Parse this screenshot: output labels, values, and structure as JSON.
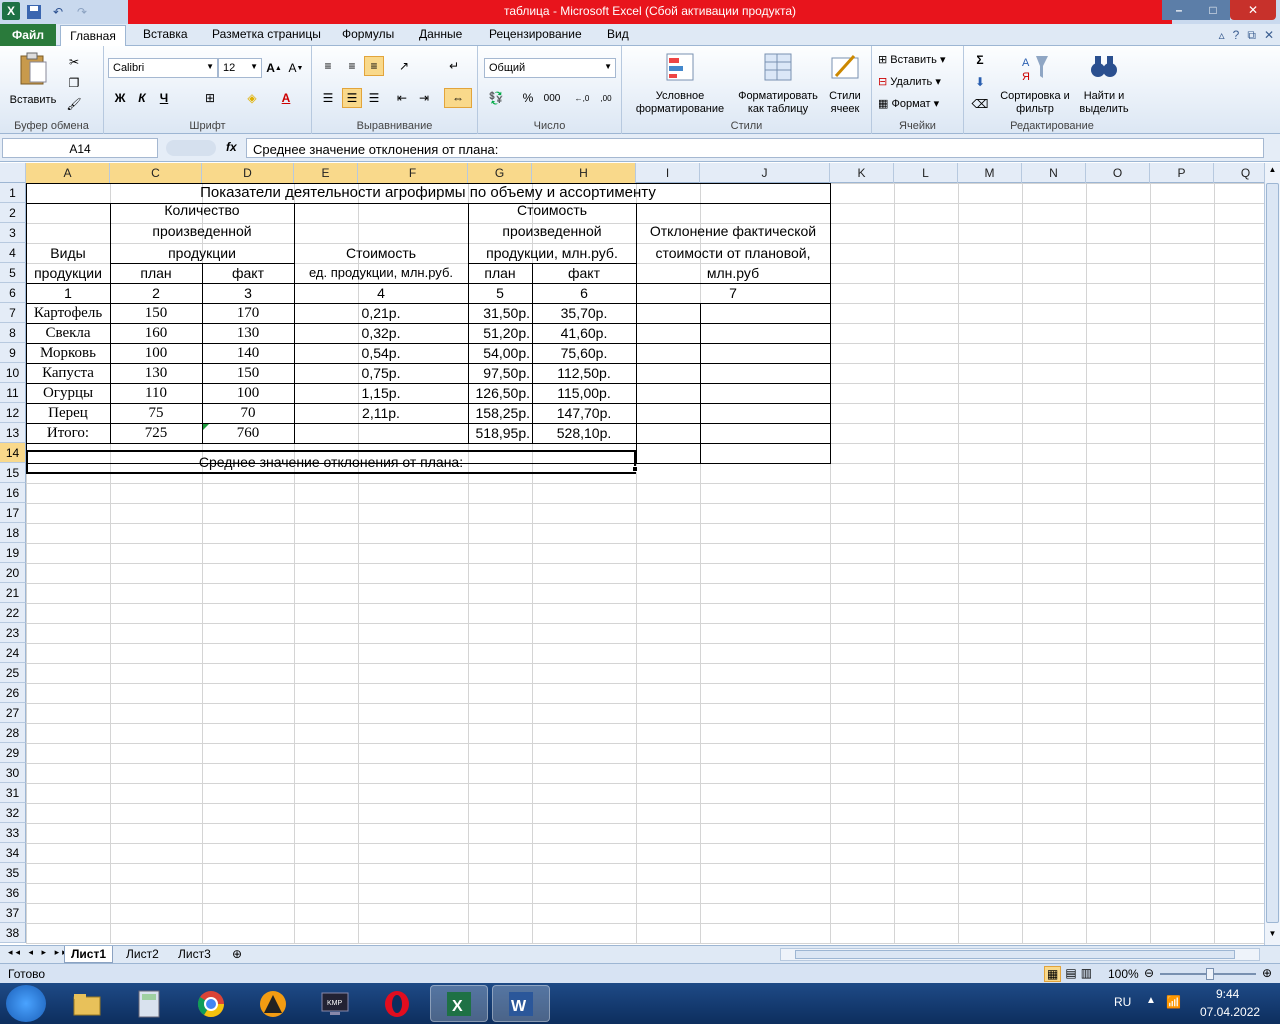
{
  "window": {
    "title": "таблица  -  Microsoft Excel (Сбой активации продукта)"
  },
  "ribbon_tabs": [
    "Файл",
    "Главная",
    "Вставка",
    "Разметка страницы",
    "Формулы",
    "Данные",
    "Рецензирование",
    "Вид"
  ],
  "ribbon": {
    "paste_label": "Вставить",
    "font_name": "Calibri",
    "font_size": "12",
    "number_format": "Общий",
    "bold": "Ж",
    "italic": "К",
    "underline": "Ч",
    "percent": "%",
    "thousands": "000",
    "dec_inc": "←,0 ,00",
    "dec_dec": ",00 →,0",
    "cond_format": "Условное форматирование",
    "format_table": "Форматировать как таблицу",
    "cell_styles": "Стили ячеек",
    "insert": "Вставить",
    "delete": "Удалить",
    "format": "Формат",
    "sort_filter": "Сортировка и фильтр",
    "find_select": "Найти и выделить",
    "groups": [
      "Буфер обмена",
      "Шрифт",
      "Выравнивание",
      "Число",
      "Стили",
      "Ячейки",
      "Редактирование"
    ]
  },
  "formula_bar": {
    "namebox": "A14",
    "fx": "fx",
    "formula": "Среднее значение отклонения от плана:"
  },
  "columns": [
    "A",
    "C",
    "D",
    "E",
    "F",
    "G",
    "H",
    "I",
    "J",
    "K",
    "L",
    "M",
    "N",
    "O",
    "P",
    "Q"
  ],
  "rows": [
    "1",
    "2",
    "3",
    "4",
    "5",
    "6",
    "7",
    "8",
    "9",
    "10",
    "11",
    "12",
    "13",
    "14",
    "15",
    "16",
    "17",
    "18",
    "19",
    "20",
    "21",
    "22",
    "23",
    "24",
    "25",
    "26",
    "27",
    "28",
    "29",
    "30",
    "31",
    "32",
    "33",
    "34",
    "35",
    "36",
    "37",
    "38"
  ],
  "sheet": {
    "title": "Показатели деятельности агрофирмы по объему и ассортименту",
    "h_kind_1": "Виды",
    "h_kind_2": "продукции",
    "h_qty_1": "Количество",
    "h_qty_2": "произведенной",
    "h_qty_3": "продукции",
    "h_plan": "план",
    "h_fact": "факт",
    "h_price_1": "Стоимость",
    "h_price_2": "ед. продукции, млн.руб.",
    "h_cost_1": "Стоимость",
    "h_cost_2": "произведенной",
    "h_cost_3": "продукции, млн.руб.",
    "h_dev_1": "Отклонение фактической",
    "h_dev_2": "стоимости от плановой,",
    "h_dev_3": "млн.руб",
    "nums": [
      "1",
      "2",
      "3",
      "4",
      "5",
      "6",
      "7"
    ],
    "data": [
      [
        "Картофель",
        "150",
        "170",
        "0,21р.",
        "31,50р.",
        "35,70р."
      ],
      [
        "Свекла",
        "160",
        "130",
        "0,32р.",
        "51,20р.",
        "41,60р."
      ],
      [
        "Морковь",
        "100",
        "140",
        "0,54р.",
        "54,00р.",
        "75,60р."
      ],
      [
        "Капуста",
        "130",
        "150",
        "0,75р.",
        "97,50р.",
        "112,50р."
      ],
      [
        "Огурцы",
        "110",
        "100",
        "1,15р.",
        "126,50р.",
        "115,00р."
      ],
      [
        "Перец",
        "75",
        "70",
        "2,11р.",
        "158,25р.",
        "147,70р."
      ]
    ],
    "total": [
      "Итого:",
      "725",
      "760",
      "",
      "518,95р.",
      "528,10р."
    ],
    "avg": "Среднее значение отклонения от плана:"
  },
  "sheet_tabs": [
    "Лист1",
    "Лист2",
    "Лист3"
  ],
  "status": {
    "ready": "Готово",
    "zoom": "100%"
  },
  "taskbar": {
    "lang": "RU",
    "time": "9:44",
    "date": "07.04.2022"
  }
}
